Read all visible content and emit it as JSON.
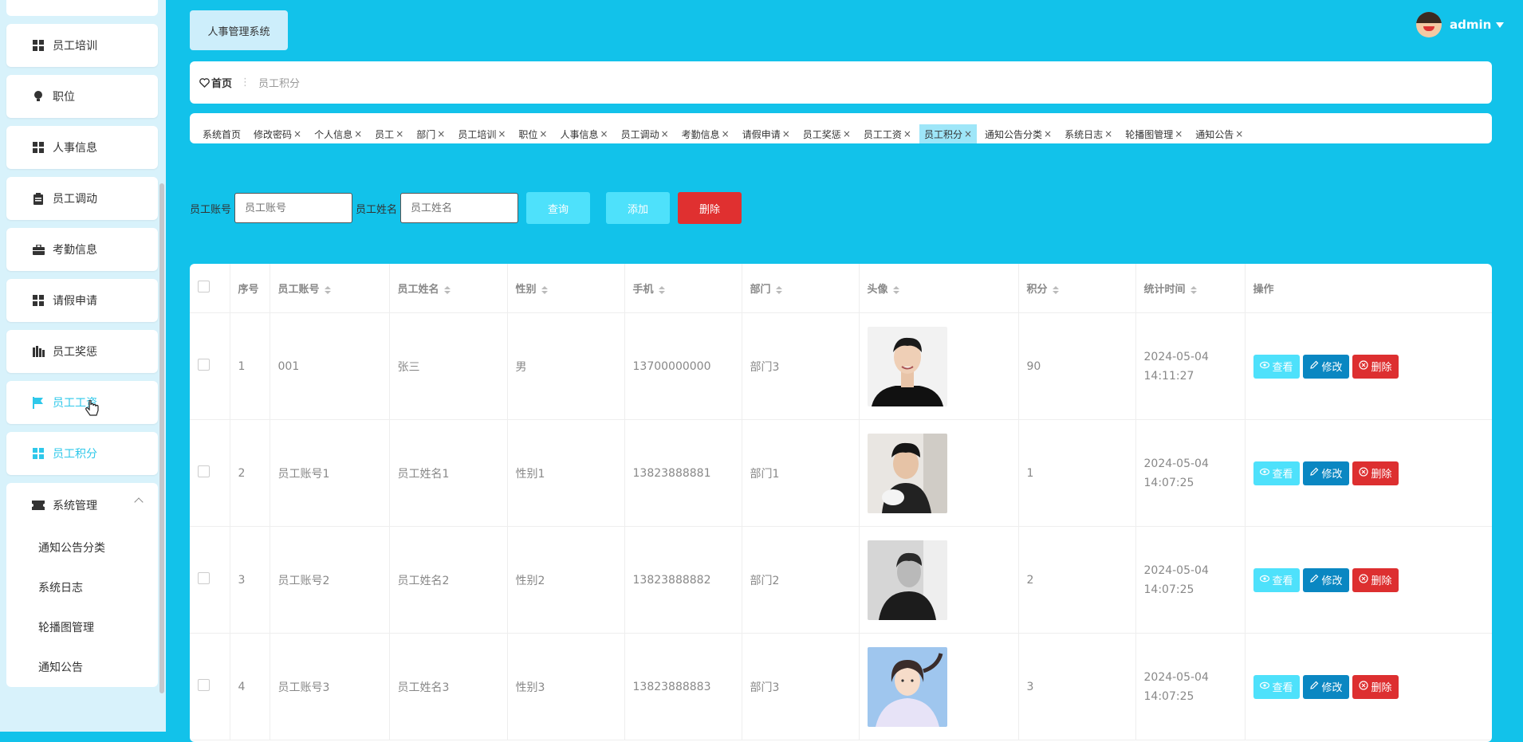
{
  "sidebar": {
    "items": [
      {
        "label": "员工培训",
        "icon": "grid-icon"
      },
      {
        "label": "职位",
        "icon": "bulb-icon"
      },
      {
        "label": "人事信息",
        "icon": "grid-icon"
      },
      {
        "label": "员工调动",
        "icon": "clipboard-icon"
      },
      {
        "label": "考勤信息",
        "icon": "briefcase-icon"
      },
      {
        "label": "请假申请",
        "icon": "grid-icon"
      },
      {
        "label": "员工奖惩",
        "icon": "building-icon"
      },
      {
        "label": "员工工资",
        "icon": "flag-icon"
      },
      {
        "label": "员工积分",
        "icon": "grid-icon"
      }
    ],
    "group": {
      "label": "系统管理",
      "children": [
        "通知公告分类",
        "系统日志",
        "轮播图管理",
        "通知公告"
      ]
    }
  },
  "header": {
    "brand": "人事管理系统",
    "user": "admin"
  },
  "breadcrumb": {
    "home": "首页",
    "current": "员工积分"
  },
  "tabs": [
    {
      "label": "系统首页",
      "closable": false
    },
    {
      "label": "修改密码",
      "closable": true
    },
    {
      "label": "个人信息",
      "closable": true
    },
    {
      "label": "员工",
      "closable": true
    },
    {
      "label": "部门",
      "closable": true
    },
    {
      "label": "员工培训",
      "closable": true
    },
    {
      "label": "职位",
      "closable": true
    },
    {
      "label": "人事信息",
      "closable": true
    },
    {
      "label": "员工调动",
      "closable": true
    },
    {
      "label": "考勤信息",
      "closable": true
    },
    {
      "label": "请假申请",
      "closable": true
    },
    {
      "label": "员工奖惩",
      "closable": true
    },
    {
      "label": "员工工资",
      "closable": true
    },
    {
      "label": "员工积分",
      "closable": true,
      "active": true
    },
    {
      "label": "通知公告分类",
      "closable": true
    },
    {
      "label": "系统日志",
      "closable": true
    },
    {
      "label": "轮播图管理",
      "closable": true
    },
    {
      "label": "通知公告",
      "closable": true
    }
  ],
  "tab_close_glyph": "×",
  "search": {
    "account_label": "员工账号",
    "account_placeholder": "员工账号",
    "name_label": "员工姓名",
    "name_placeholder": "员工姓名",
    "query_button": "查询",
    "add_button": "添加",
    "delete_button": "删除"
  },
  "colors": {
    "accent": "#12c2ea",
    "query_button": "#4ee1fb",
    "add_button": "#4ee1fb",
    "delete_button": "#e03030",
    "view_button": "#4ee1fb",
    "edit_button": "#0a87c2",
    "row_delete_button": "#dd2f30"
  },
  "table": {
    "columns": [
      "",
      "序号",
      "员工账号",
      "员工姓名",
      "性别",
      "手机",
      "部门",
      "头像",
      "积分",
      "统计时间",
      "操作"
    ],
    "rows": [
      {
        "no": "1",
        "account": "001",
        "name": "张三",
        "gender": "男",
        "phone": "13700000000",
        "dept": "部门3",
        "photo": "portrait-man-smiling",
        "score": "90",
        "time": "2024-05-04 14:11:27"
      },
      {
        "no": "2",
        "account": "员工账号1",
        "name": "员工姓名1",
        "gender": "性别1",
        "phone": "13823888881",
        "dept": "部门1",
        "photo": "portrait-young-man",
        "score": "1",
        "time": "2024-05-04 14:07:25"
      },
      {
        "no": "3",
        "account": "员工账号2",
        "name": "员工姓名2",
        "gender": "性别2",
        "phone": "13823888882",
        "dept": "部门2",
        "photo": "portrait-man-bw",
        "score": "2",
        "time": "2024-05-04 14:07:25"
      },
      {
        "no": "4",
        "account": "员工账号3",
        "name": "员工姓名3",
        "gender": "性别3",
        "phone": "13823888883",
        "dept": "部门3",
        "photo": "portrait-girl",
        "score": "3",
        "time": "2024-05-04 14:07:25"
      }
    ],
    "actions": {
      "view": "查看",
      "edit": "修改",
      "delete": "删除"
    }
  }
}
